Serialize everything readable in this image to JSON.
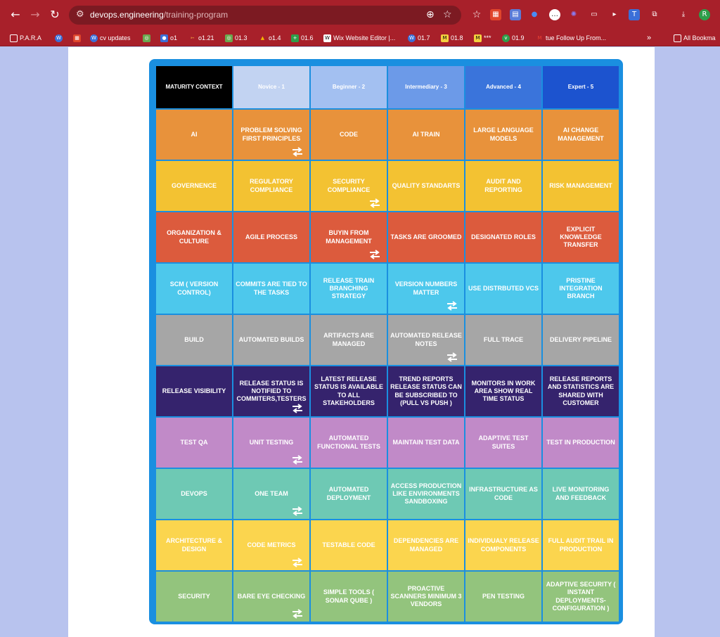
{
  "browser": {
    "url_domain": "devops.engineering",
    "url_path": "/training-program",
    "bookmarks": [
      {
        "label": "P.A.R.A",
        "color": "#ffffff"
      },
      {
        "label": "",
        "color": "#3b6fd8"
      },
      {
        "label": "",
        "color": "#e0452b"
      },
      {
        "label": "cv updates",
        "color": "#3b6fd8"
      },
      {
        "label": "",
        "color": "#6aa84f"
      },
      {
        "label": "o1",
        "color": "#3b6fd8"
      },
      {
        "label": "o1.21",
        "color": "#e06b2b"
      },
      {
        "label": "01.3",
        "color": "#6aa84f"
      },
      {
        "label": "o1.4",
        "color": "#f4b400"
      },
      {
        "label": "01.6",
        "color": "#2e9e4a"
      },
      {
        "label": "Wix Website Editor |...",
        "color": "#222222"
      },
      {
        "label": "01.7",
        "color": "#3b6fd8"
      },
      {
        "label": "01.8",
        "color": "#f4d03f"
      },
      {
        "label": "***",
        "color": "#f4d03f"
      },
      {
        "label": "01.9",
        "color": "#2e9e4a"
      },
      {
        "label": "tue Follow Up From...",
        "color": "#d93025"
      }
    ],
    "all_bookmarks": "All Bookma"
  },
  "matrix": {
    "headers": [
      {
        "label": "MATURITY CONTEXT",
        "bg": "#000000"
      },
      {
        "label": "Novice - 1",
        "bg": "#c2d3f2"
      },
      {
        "label": "Beginner - 2",
        "bg": "#a3c0f1"
      },
      {
        "label": "Intermediary - 3",
        "bg": "#6c9ae8"
      },
      {
        "label": "Advanced - 4",
        "bg": "#3a74db"
      },
      {
        "label": "Expert - 5",
        "bg": "#1c53cf"
      }
    ],
    "rows": [
      {
        "bg": "#e8923b",
        "cells": [
          "AI",
          "PROBLEM SOLVING FIRST PRINCIPLES",
          "CODE",
          "AI TRAIN",
          "LARGE LANGUAGE MODELS",
          "AI CHANGE MANAGEMENT"
        ],
        "arrows": [
          1
        ]
      },
      {
        "bg": "#f3c232",
        "cells": [
          "GOVERNENCE",
          "REGULATORY COMPLIANCE",
          "SECURITY COMPLIANCE",
          "QUALITY STANDARTS",
          "AUDIT AND REPORTING",
          "RISK MANAGEMENT"
        ],
        "arrows": [
          2
        ]
      },
      {
        "bg": "#dc5b3d",
        "cells": [
          "ORGANIZATION & CULTURE",
          "AGILE PROCESS",
          "BUYIN FROM MANAGEMENT",
          "TASKS ARE GROOMED",
          "DESIGNATED ROLES",
          "EXPLICIT KNOWLEDGE TRANSFER"
        ],
        "arrows": [
          2
        ]
      },
      {
        "bg": "#4dc8ec",
        "cells": [
          "SCM ( VERSION CONTROL)",
          "COMMITS ARE TIED TO THE TASKS",
          "RELEASE TRAIN BRANCHING STRATEGY",
          "VERSION NUMBERS MATTER",
          "USE DISTRBUTED VCS",
          "PRISTINE INTEGRATION BRANCH"
        ],
        "arrows": [
          3
        ]
      },
      {
        "bg": "#a6a6a6",
        "cells": [
          "BUILD",
          "AUTOMATED BUILDS",
          "ARTIFACTS ARE MANAGED",
          "AUTOMATED RELEASE NOTES",
          "FULL TRACE",
          "DELIVERY PIPELINE"
        ],
        "arrows": [
          3
        ]
      },
      {
        "bg": "#35236d",
        "cells": [
          "RELEASE VISIBILITY",
          "RELEASE STATUS IS NOTIFIED TO COMMITERS,TESTERS",
          "LATEST RELEASE STATUS IS AVAILABLE TO ALL STAKEHOLDERS",
          "TREND REPORTS RELEASE STATUS CAN BE SUBSCRIBED TO (PULL VS PUSH )",
          "MONITORS IN WORK AREA SHOW REAL TIME STATUS",
          "RELEASE REPORTS AND STATISTICS ARE SHARED WITH CUSTOMER"
        ],
        "arrows": [
          1
        ]
      },
      {
        "bg": "#c18ac8",
        "cells": [
          "TEST QA",
          "UNIT TESTING",
          "AUTOMATED FUNCTIONAL TESTS",
          "MAINTAIN TEST DATA",
          "ADAPTIVE TEST SUITES",
          "TEST IN PRODUCTION"
        ],
        "arrows": [
          1
        ]
      },
      {
        "bg": "#6ec9b4",
        "cells": [
          "DEVOPS",
          "ONE TEAM",
          "AUTOMATED DEPLOYMENT",
          "ACCESS PRODUCTION LIKE ENVIRONMENTS SANDBOXING",
          "INFRASTRUCTURE AS CODE",
          "LIVE MONITORING AND FEEDBACK"
        ],
        "arrows": [
          1
        ]
      },
      {
        "bg": "#fbd54e",
        "cells": [
          "ARCHITECTURE & DESIGN",
          "CODE METRICS",
          "TESTABLE CODE",
          "DEPENDENCIES ARE MANAGED",
          "INDIVIDUALY RELEASE COMPONENTS",
          "FULL AUDIT TRAIL IN PRODUCTION"
        ],
        "arrows": [
          1
        ]
      },
      {
        "bg": "#93c47d",
        "cells": [
          "SECURITY",
          "BARE EYE CHECKING",
          "SIMPLE TOOLS ( SONAR QUBE )",
          "PROACTIVE SCANNERS minimum 3 vendors",
          "PEN TESTING",
          "ADAPTIVE SECURITY ( INSTANT DEPLOYMENTS-CONFIGURATION )"
        ],
        "arrows": [
          1
        ]
      }
    ]
  }
}
